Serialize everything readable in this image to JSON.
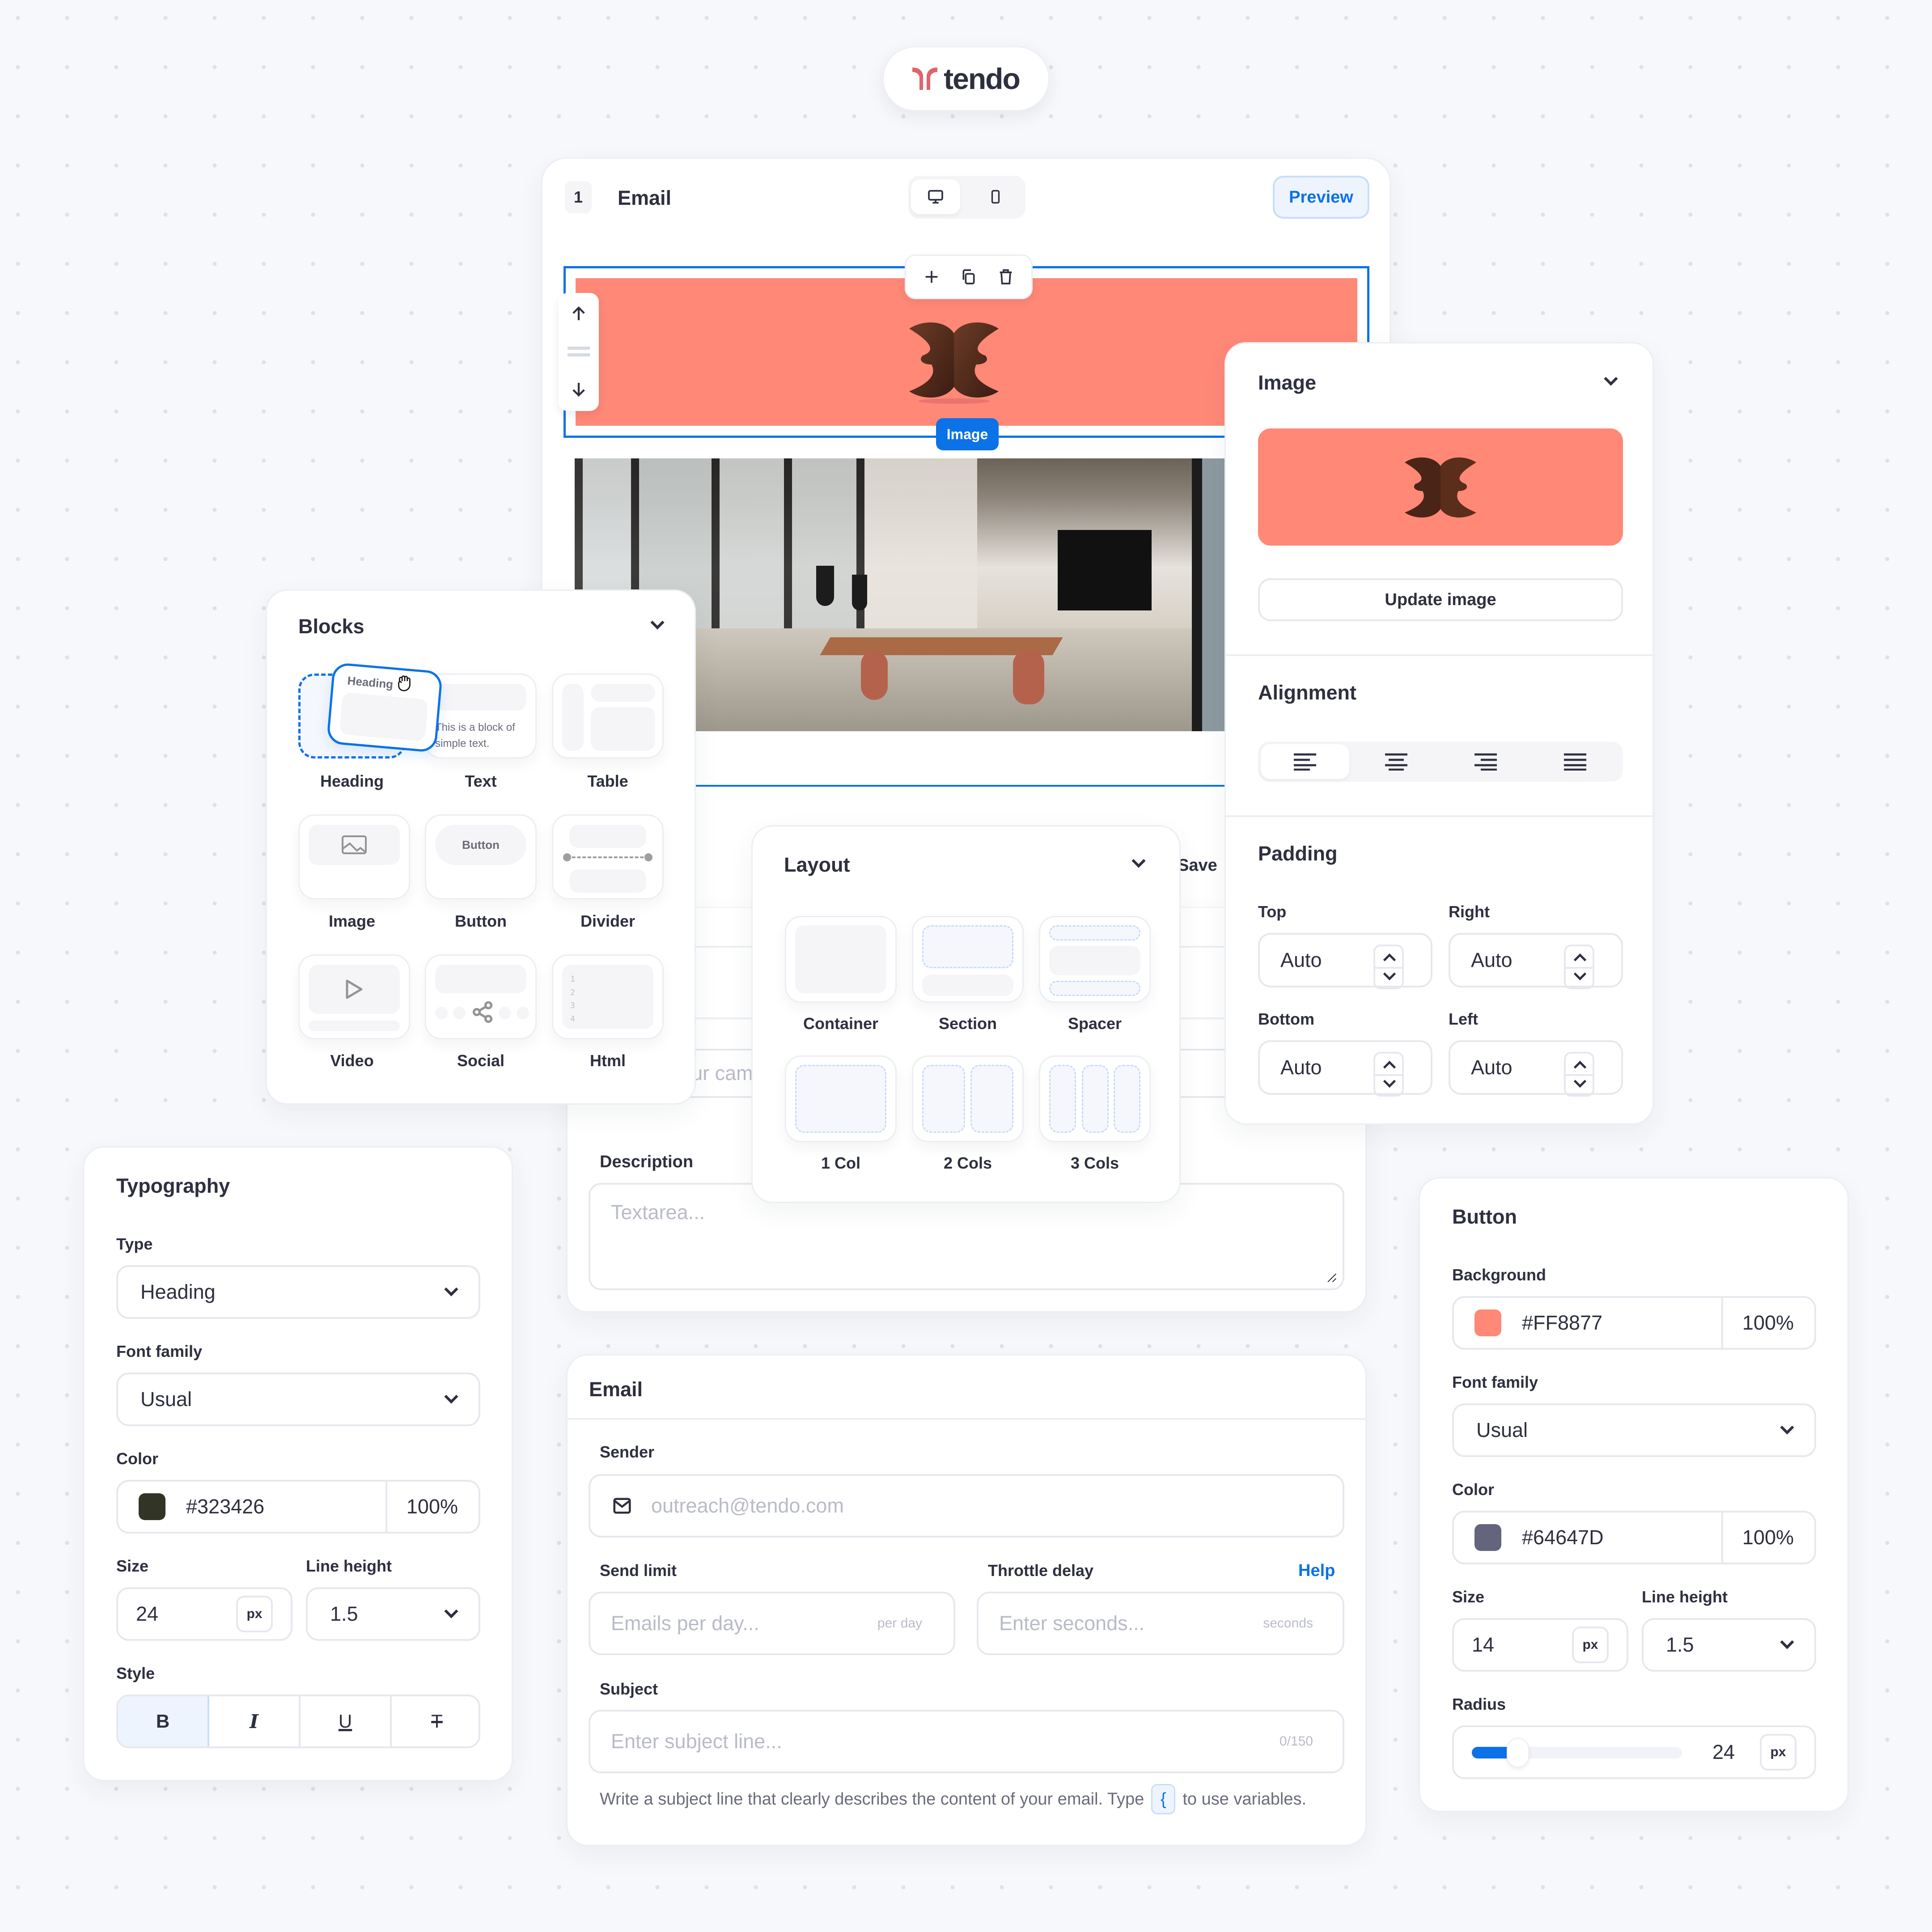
{
  "brand": {
    "name": "tendo",
    "accent": "#E0646B",
    "text_color": "#2E3040"
  },
  "colors": {
    "primary": "#0B72E7",
    "coral": "#FF8877",
    "border": "#E7E8EE"
  },
  "editor": {
    "step_number": "1",
    "title": "Email",
    "device_toggle": [
      {
        "icon": "desktop-icon",
        "selected": true
      },
      {
        "icon": "mobile-icon",
        "selected": false
      }
    ],
    "preview_label": "Preview",
    "block_toolbar": [
      "plus-icon",
      "copy-icon",
      "trash-icon"
    ],
    "move_controls": [
      "arrow-up-icon",
      "drag-handle-icon",
      "arrow-down-icon"
    ],
    "selected_block_badge": "Image",
    "save_label": "Save"
  },
  "campaign_form": {
    "name_placeholder": "Name your campaign...",
    "description_label": "Description",
    "description_placeholder": "Textarea..."
  },
  "blocks_panel": {
    "title": "Blocks",
    "dragging": {
      "label": "Heading"
    },
    "text_preview": "This is a block of simple text.",
    "button_preview": "Button",
    "html_line_numbers": [
      "1",
      "2",
      "3",
      "4"
    ],
    "items": [
      {
        "label": "Heading"
      },
      {
        "label": "Text"
      },
      {
        "label": "Table"
      },
      {
        "label": "Image"
      },
      {
        "label": "Button"
      },
      {
        "label": "Divider"
      },
      {
        "label": "Video"
      },
      {
        "label": "Social"
      },
      {
        "label": "Html"
      }
    ]
  },
  "layout_panel": {
    "title": "Layout",
    "items": [
      {
        "label": "Container"
      },
      {
        "label": "Section"
      },
      {
        "label": "Spacer"
      },
      {
        "label": "1 Col"
      },
      {
        "label": "2 Cols"
      },
      {
        "label": "3 Cols"
      }
    ]
  },
  "image_panel": {
    "title": "Image",
    "update_button": "Update image",
    "alignment": {
      "title": "Alignment",
      "options": [
        "align-left-icon",
        "align-center-icon",
        "align-right-icon",
        "align-justify-icon"
      ],
      "selected": 0
    },
    "padding": {
      "title": "Padding",
      "fields": [
        {
          "label": "Top",
          "value": "Auto"
        },
        {
          "label": "Right",
          "value": "Auto"
        },
        {
          "label": "Bottom",
          "value": "Auto"
        },
        {
          "label": "Left",
          "value": "Auto"
        }
      ]
    }
  },
  "typography_panel": {
    "title": "Typography",
    "type_label": "Type",
    "type_value": "Heading",
    "font_family_label": "Font family",
    "font_family_value": "Usual",
    "color_label": "Color",
    "color_hex": "#323426",
    "color_opacity": "100%",
    "size_label": "Size",
    "size_value": "24",
    "size_unit": "px",
    "line_height_label": "Line height",
    "line_height_value": "1.5",
    "style_label": "Style",
    "style_buttons": [
      {
        "glyph": "B",
        "icon": "bold-icon",
        "active": true
      },
      {
        "glyph": "I",
        "icon": "italic-icon",
        "active": false
      },
      {
        "glyph": "U",
        "icon": "underline-icon",
        "active": false
      },
      {
        "glyph": "T",
        "icon": "strikethrough-icon",
        "active": false
      }
    ]
  },
  "email_panel": {
    "title": "Email",
    "sender_label": "Sender",
    "sender_placeholder": "outreach@tendo.com",
    "send_limit_label": "Send limit",
    "send_limit_placeholder": "Emails per day...",
    "send_limit_suffix": "per day",
    "throttle_label": "Throttle delay",
    "throttle_help": "Help",
    "throttle_placeholder": "Enter seconds...",
    "throttle_suffix": "seconds",
    "subject_label": "Subject",
    "subject_placeholder": "Enter subject line...",
    "subject_counter": "0/150",
    "hint_before": "Write a subject line that clearly describes the content of your email. Type",
    "hint_key": "{",
    "hint_after": "to use variables."
  },
  "button_panel": {
    "title": "Button",
    "background_label": "Background",
    "background_hex": "#FF8877",
    "background_opacity": "100%",
    "font_family_label": "Font family",
    "font_family_value": "Usual",
    "color_label": "Color",
    "color_hex": "#64647D",
    "color_opacity": "100%",
    "size_label": "Size",
    "size_value": "14",
    "size_unit": "px",
    "line_height_label": "Line height",
    "line_height_value": "1.5",
    "radius_label": "Radius",
    "radius_value": "24",
    "radius_unit": "px",
    "radius_fill_fraction": 0.22
  }
}
